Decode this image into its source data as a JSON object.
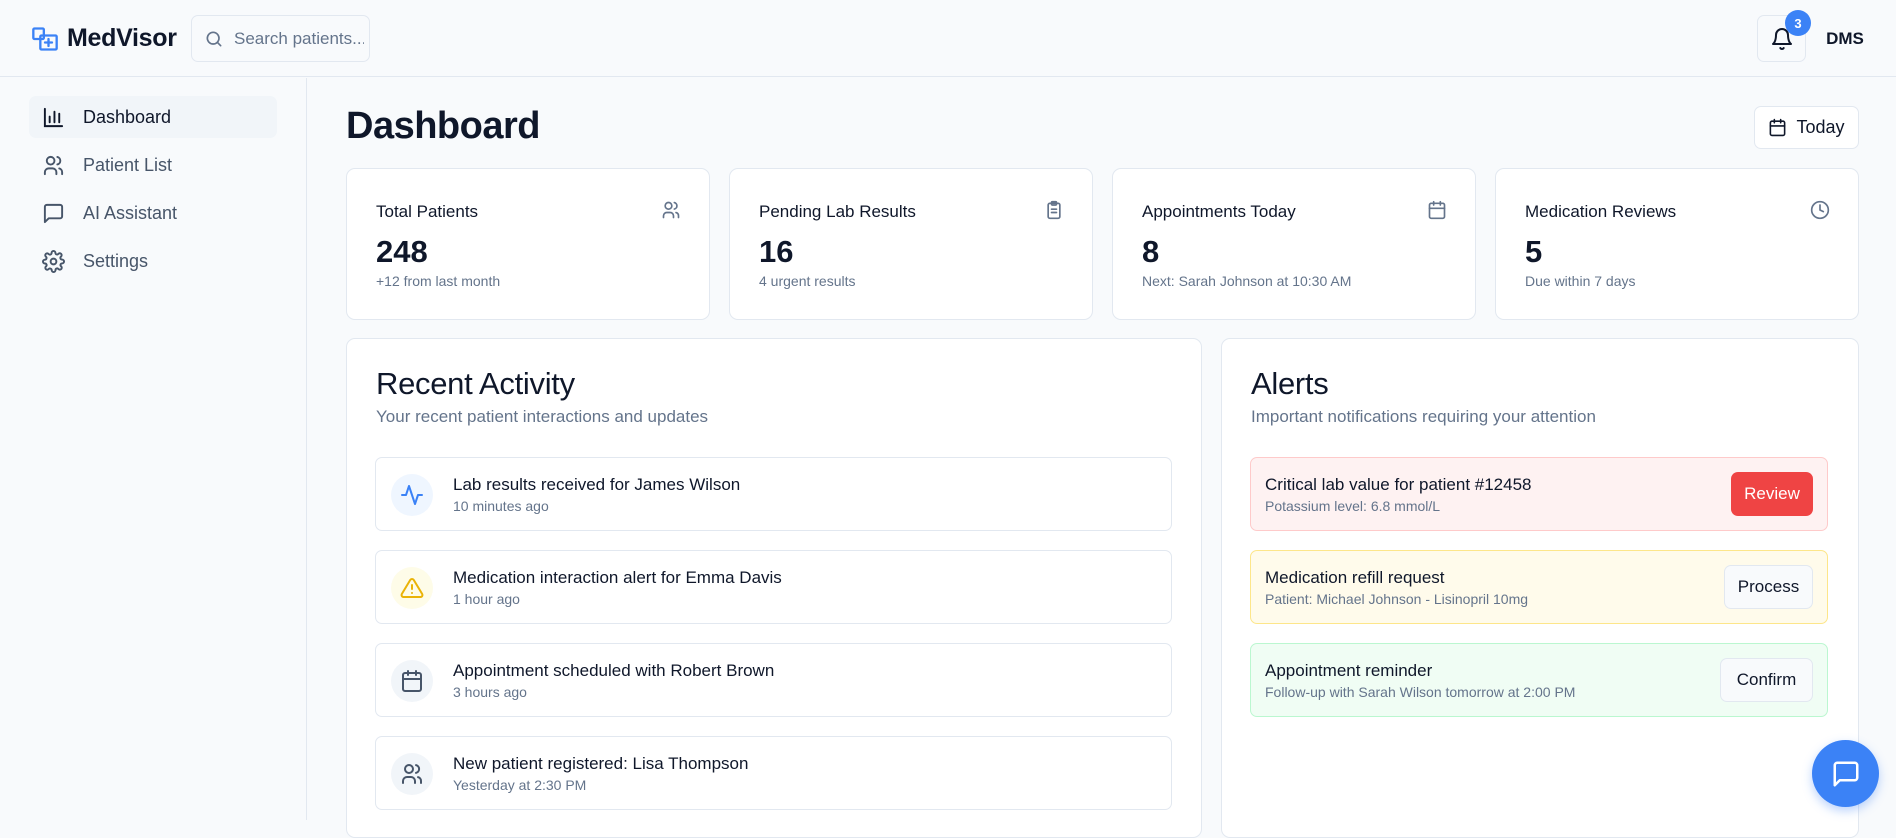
{
  "app": {
    "name": "MedVisor",
    "logo_icon": "hospital-icon"
  },
  "header": {
    "search_placeholder": "Search patients...",
    "notification_count": "3",
    "user_initials": "DMS"
  },
  "sidebar": {
    "items": [
      {
        "label": "Dashboard",
        "icon": "bar-chart-icon",
        "active": true
      },
      {
        "label": "Patient List",
        "icon": "users-icon",
        "active": false
      },
      {
        "label": "AI Assistant",
        "icon": "message-square-icon",
        "active": false
      },
      {
        "label": "Settings",
        "icon": "gear-icon",
        "active": false
      }
    ]
  },
  "main": {
    "title": "Dashboard",
    "date_button": "Today",
    "stats": [
      {
        "title": "Total Patients",
        "value": "248",
        "sub": "+12 from last month",
        "icon": "users-icon"
      },
      {
        "title": "Pending Lab Results",
        "value": "16",
        "sub": "4 urgent results",
        "icon": "clipboard-icon"
      },
      {
        "title": "Appointments Today",
        "value": "8",
        "sub": "Next: Sarah Johnson at 10:30 AM",
        "icon": "calendar-icon"
      },
      {
        "title": "Medication Reviews",
        "value": "5",
        "sub": "Due within 7 days",
        "icon": "clock-icon"
      }
    ],
    "recent_activity": {
      "title": "Recent Activity",
      "description": "Your recent patient interactions and updates",
      "items": [
        {
          "title": "Lab results received for James Wilson",
          "time": "10 minutes ago",
          "icon": "activity-icon"
        },
        {
          "title": "Medication interaction alert for Emma Davis",
          "time": "1 hour ago",
          "icon": "warning-icon"
        },
        {
          "title": "Appointment scheduled with Robert Brown",
          "time": "3 hours ago",
          "icon": "calendar-icon"
        },
        {
          "title": "New patient registered: Lisa Thompson",
          "time": "Yesterday at 2:30 PM",
          "icon": "users-icon"
        }
      ]
    },
    "alerts": {
      "title": "Alerts",
      "description": "Important notifications requiring your attention",
      "items": [
        {
          "title": "Critical lab value for patient #12458",
          "sub": "Potassium level: 6.8 mmol/L",
          "button": "Review",
          "tone": "critical"
        },
        {
          "title": "Medication refill request",
          "sub": "Patient: Michael Johnson - Lisinopril 10mg",
          "button": "Process",
          "tone": "warning"
        },
        {
          "title": "Appointment reminder",
          "sub": "Follow-up with Sarah Wilson tomorrow at 2:00 PM",
          "button": "Confirm",
          "tone": "info"
        }
      ]
    }
  },
  "colors": {
    "accent": "#3b82f6",
    "critical": "#ef4444",
    "critical_bg": "#fef2f2",
    "warning_bg": "#fffbeb",
    "info_bg": "#f0fdf4"
  },
  "fab_icon": "chat-icon"
}
